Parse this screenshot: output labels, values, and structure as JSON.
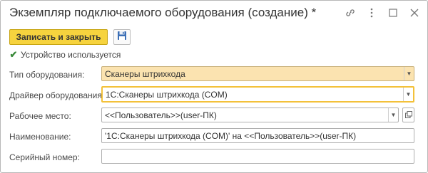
{
  "window": {
    "title": "Экземпляр подключаемого оборудования (создание) *",
    "icons": [
      "link-icon",
      "more-icon",
      "maximize-icon",
      "close-icon"
    ]
  },
  "toolbar": {
    "save_close_label": "Записать и закрыть",
    "save_icon": "floppy-disk-icon"
  },
  "form": {
    "device_used": {
      "label": "Устройство используется",
      "checked": true
    },
    "equipment_type": {
      "label": "Тип оборудования:",
      "value": "Сканеры штрихкода"
    },
    "driver": {
      "label": "Драйвер оборудования:",
      "value": "1С:Сканеры штрихкода (COM)"
    },
    "workplace": {
      "label": "Рабочее место:",
      "value": "<<Пользователь>>(user-ПК)"
    },
    "name": {
      "label": "Наименование:",
      "value": "'1С:Сканеры штрихкода (COM)' на <<Пользователь>>(user-ПК)"
    },
    "serial": {
      "label": "Серийный номер:",
      "value": ""
    }
  },
  "colors": {
    "accent_button": "#f6d33e",
    "highlight_field": "#fbe3b0",
    "focus_border": "#f3c13a",
    "check": "#3a8a3a"
  }
}
